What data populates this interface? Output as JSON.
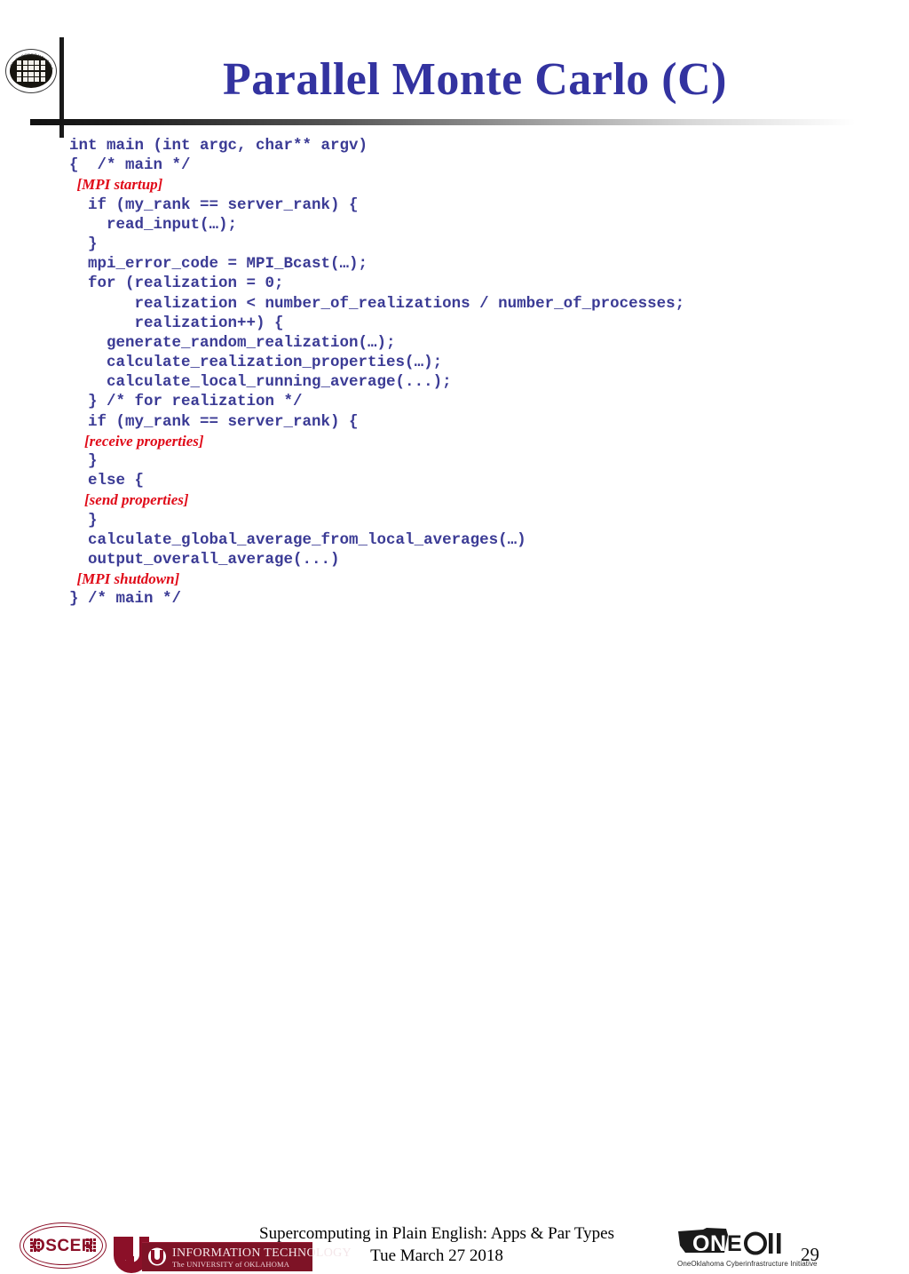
{
  "slide": {
    "title": "Parallel Monte Carlo (C)",
    "number": "29",
    "title_color": "#3333a0",
    "code_color": "#3b3b95",
    "note_color": "#e00a18"
  },
  "code_lines": [
    {
      "kind": "code",
      "text": "int main (int argc, char** argv)"
    },
    {
      "kind": "code",
      "text": "{  /* main */"
    },
    {
      "kind": "note",
      "text": "  [MPI startup]"
    },
    {
      "kind": "code",
      "text": "  if (my_rank == server_rank) {"
    },
    {
      "kind": "code",
      "text": "    read_input(…);"
    },
    {
      "kind": "code",
      "text": "  }"
    },
    {
      "kind": "code",
      "text": "  mpi_error_code = MPI_Bcast(…);"
    },
    {
      "kind": "code",
      "text": "  for (realization = 0;"
    },
    {
      "kind": "code",
      "text": "       realization < number_of_realizations / number_of_processes;"
    },
    {
      "kind": "code",
      "text": "       realization++) {"
    },
    {
      "kind": "code",
      "text": "    generate_random_realization(…);"
    },
    {
      "kind": "code",
      "text": "    calculate_realization_properties(…);"
    },
    {
      "kind": "code",
      "text": "    calculate_local_running_average(...);"
    },
    {
      "kind": "code",
      "text": "  } /* for realization */"
    },
    {
      "kind": "code",
      "text": "  if (my_rank == server_rank) {"
    },
    {
      "kind": "note",
      "text": "    [receive properties]"
    },
    {
      "kind": "code",
      "text": "  }"
    },
    {
      "kind": "code",
      "text": "  else {"
    },
    {
      "kind": "note",
      "text": "    [send properties]"
    },
    {
      "kind": "code",
      "text": "  }"
    },
    {
      "kind": "code",
      "text": "  calculate_global_average_from_local_averages(…)"
    },
    {
      "kind": "code",
      "text": "  output_overall_average(...)"
    },
    {
      "kind": "note",
      "text": "  [MPI shutdown]"
    },
    {
      "kind": "code",
      "text": "} /* main */"
    }
  ],
  "footer": {
    "line1": "Supercomputing in Plain English: Apps & Par Types",
    "line2": "Tue March 27 2018",
    "oscer_label": "OSCER",
    "it_banner_line1": "INFORMATION TECHNOLOGY",
    "it_banner_line2": "The UNIVERSITY of OKLAHOMA",
    "oneocii_name": "ONEOCII",
    "oneocii_tagline": "OneOklahoma Cyberinfrastructure Initiative"
  }
}
